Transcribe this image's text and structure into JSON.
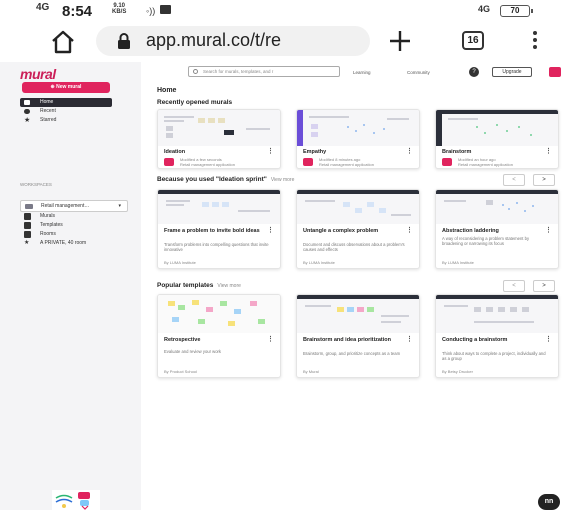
{
  "status_bar": {
    "network": "4G",
    "time": "8:54",
    "speed_value": "9.10",
    "speed_unit": "KB/S",
    "network_right": "4G",
    "battery": "70"
  },
  "browser": {
    "url": "app.mural.co/t/re",
    "tab_count": "16",
    "icons": [
      "home-icon",
      "lock-icon",
      "plus-icon",
      "tabs-icon",
      "more-vertical-icon"
    ]
  },
  "sidebar": {
    "logo": "mural",
    "new_button": "New mural",
    "nav": [
      {
        "label": "Home",
        "icon": "home-icon",
        "active": true
      },
      {
        "label": "Recent",
        "icon": "clock-icon",
        "active": false
      },
      {
        "label": "Starred",
        "icon": "star-icon",
        "active": false
      }
    ],
    "workspace_heading": "WORKSPACES",
    "workspace": "Retail management…",
    "links": [
      {
        "label": "Murals",
        "icon": "murals-icon"
      },
      {
        "label": "Templates",
        "icon": "templates-icon"
      },
      {
        "label": "Rooms",
        "icon": "rooms-icon"
      },
      {
        "label": "A PRIVATE, 40 room",
        "icon": "star-icon"
      }
    ]
  },
  "topbar": {
    "search_placeholder": "Search for murals, templates, and r",
    "learning": "Learning",
    "community": "Community",
    "help": "?",
    "upgrade": "Upgrade"
  },
  "main": {
    "title": "Home",
    "recent": {
      "title": "Recently opened murals",
      "cards": [
        {
          "title": "Ideation",
          "meta1": "Modified a few seconds",
          "meta2": "Retail management application"
        },
        {
          "title": "Empathy",
          "meta1": "Modified 8 minutes ago",
          "meta2": "Retail management application"
        },
        {
          "title": "Brainstorm",
          "meta1": "Modified an hour ago",
          "meta2": "Retail management application"
        }
      ]
    },
    "because": {
      "title": "Because you used \"Ideation sprint\"",
      "view_more": "View more",
      "prev": "<",
      "next": ">",
      "cards": [
        {
          "title": "Frame a problem to invite bold ideas",
          "desc": "Transform problems into compelling questions that invite innovative",
          "author": "By LUMA Institute"
        },
        {
          "title": "Untangle a complex problem",
          "desc": "Document and discuss observations about a problem's causes and effects",
          "author": "By LUMA Institute"
        },
        {
          "title": "Abstraction laddering",
          "desc": "A way of reconsidering a problem statement by broadening or narrowing its focus",
          "author": "By LUMA Institute"
        }
      ]
    },
    "popular": {
      "title": "Popular templates",
      "view_more": "View more",
      "prev": "<",
      "next": ">",
      "cards": [
        {
          "title": "Retrospective",
          "desc": "Evaluate and review your work",
          "author": "By Product School"
        },
        {
          "title": "Brainstorm and idea prioritization",
          "desc": "Brainstorm, group, and prioritize concepts as a team",
          "author": "By Mural"
        },
        {
          "title": "Conducting a brainstorm",
          "desc": "Think about ways to complete a project, individually and as a group",
          "author": "By Betsy Drucker"
        }
      ]
    }
  },
  "chat_fab": "nn",
  "colors": {
    "brand": "#e0245e",
    "sidebar_bg": "#f4f4f6",
    "active_nav": "#2b2b33"
  }
}
